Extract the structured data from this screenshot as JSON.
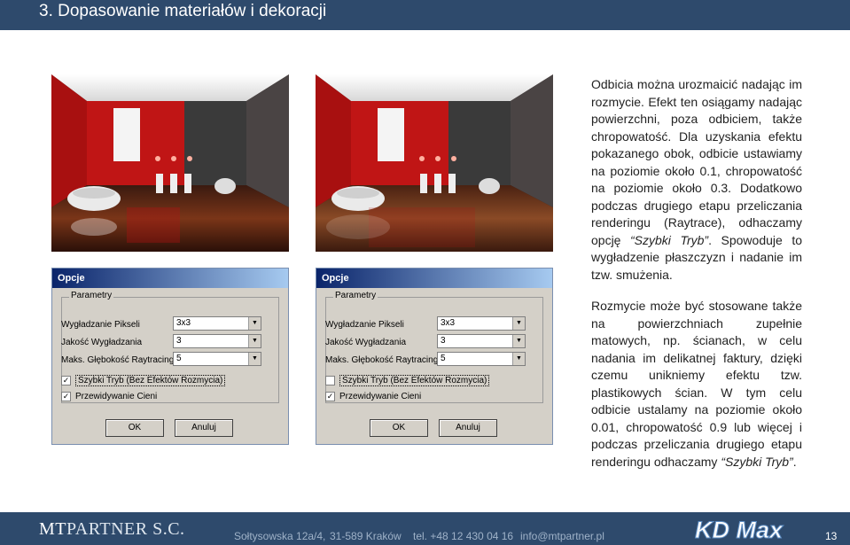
{
  "header": {
    "title": "3.  Dopasowanie materiałów i dekoracji"
  },
  "dialogs": [
    {
      "title": "Opcje",
      "group_label": "Parametry",
      "rows": [
        {
          "label": "Wygładzanie Pikseli",
          "value": "3x3"
        },
        {
          "label": "Jakość Wygładzania",
          "value": "3"
        },
        {
          "label": "Maks. Głębokość Raytracingu",
          "value": "5"
        }
      ],
      "checks": [
        {
          "label": "Szybki Tryb (Bez Efektów Rozmycia)",
          "checked": "✓"
        },
        {
          "label": "Przewidywanie Cieni",
          "checked": "✓"
        }
      ],
      "ok_label": "OK",
      "cancel_label": "Anuluj"
    },
    {
      "title": "Opcje",
      "group_label": "Parametry",
      "rows": [
        {
          "label": "Wygładzanie Pikseli",
          "value": "3x3"
        },
        {
          "label": "Jakość Wygładzania",
          "value": "3"
        },
        {
          "label": "Maks. Głębokość Raytracingu",
          "value": "5"
        }
      ],
      "checks": [
        {
          "label": "Szybki Tryb (Bez Efektów Rozmycia)",
          "checked": ""
        },
        {
          "label": "Przewidywanie Cieni",
          "checked": "✓"
        }
      ],
      "ok_label": "OK",
      "cancel_label": "Anuluj"
    }
  ],
  "text": {
    "p1_a": "Odbicia można urozmaicić nadając im rozmycie. Efekt ten osiągamy nadając powierzchni, poza odbiciem, także chropowatość. Dla uzyskania efektu pokazanego obok, odbicie ustawiamy na poziomie około 0.1, chropowatość na poziomie około 0.3. Dodatkowo podczas drugiego etapu przeliczania renderingu (Raytrace), odhaczamy opcję ",
    "p1_em": "“Szybki Tryb”",
    "p1_b": ". Spowoduje to wygładzenie płaszczyzn i nadanie im tzw. smużenia.",
    "p2_a": "Rozmycie może być stosowane także na powierzchniach zupełnie matowych, np. ścianach, w celu nadania im delikatnej faktury, dzięki czemu unikniemy efektu tzw. plastikowych ścian. W tym celu odbicie ustalamy na poziomie około 0.01, chropowatość 0.9 lub więcej i podczas przeliczania drugiego etapu renderingu odhaczamy ",
    "p2_em": "“Szybki Tryb”",
    "p2_b": "."
  },
  "footer": {
    "brand_mt": "MT",
    "brand_rest": "PARTNER S.C.",
    "address": "Sołtysowska 12a/4,",
    "city": "31-589 Kraków",
    "phone": "tel. +48 12 430 04 16",
    "email": "info@mtpartner.pl",
    "logo": "KD Max",
    "page": "13"
  },
  "colors": {
    "header_bg": "#2e4a6c",
    "wall_red": "#b51212",
    "floor_brown": "#5a2412"
  }
}
